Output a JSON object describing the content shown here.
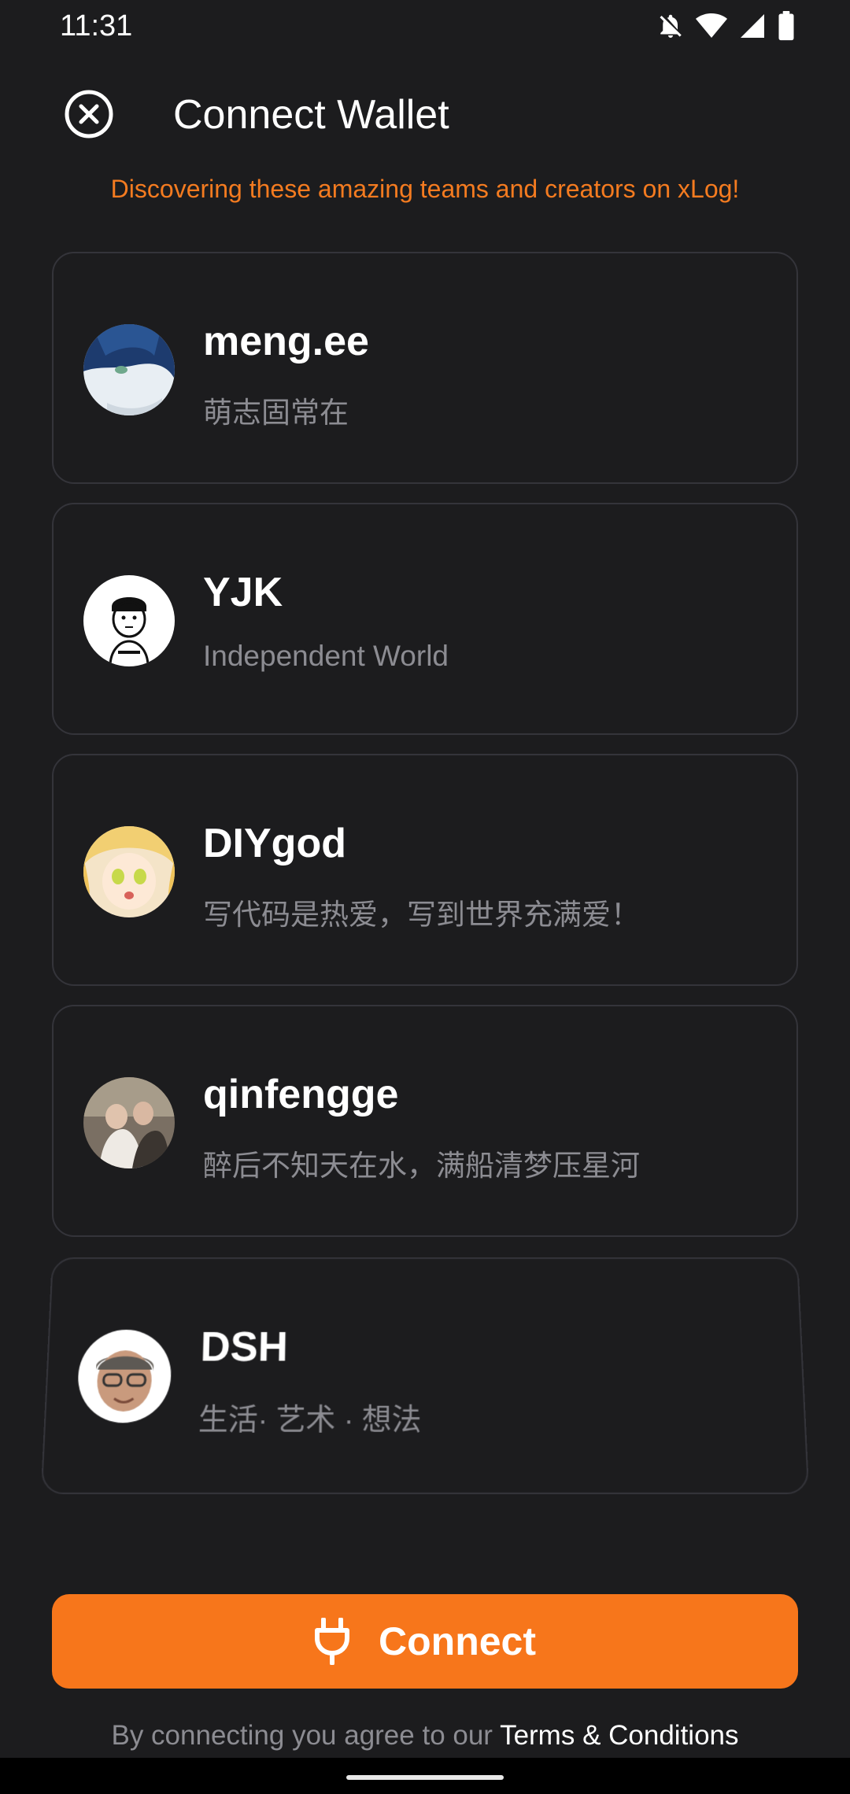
{
  "status_bar": {
    "time": "11:31",
    "icons": [
      "notifications-off-icon",
      "wifi-icon",
      "cellular-signal-icon",
      "battery-icon"
    ]
  },
  "header": {
    "title": "Connect Wallet",
    "close_icon": "close-circle-icon"
  },
  "subtitle": "Discovering these amazing teams and creators on xLog!",
  "creators": [
    {
      "name": "meng.ee",
      "description": "萌志固常在",
      "avatar": "anime-avatar-blue"
    },
    {
      "name": "YJK",
      "description": "Independent World",
      "avatar": "cartoon-avatar-boy"
    },
    {
      "name": "DIYgod",
      "description": "写代码是热爱，写到世界充满爱！",
      "avatar": "anime-avatar-blonde"
    },
    {
      "name": "qinfengge",
      "description": "醉后不知天在水，满船清梦压星河",
      "avatar": "photo-avatar-couple"
    },
    {
      "name": "DSH",
      "description": "生活· 艺术 · 想法",
      "avatar": "memoji-avatar"
    }
  ],
  "connect_button": {
    "label": "Connect",
    "icon": "plug-icon"
  },
  "terms": {
    "prefix": "By connecting you agree to our",
    "link": "Terms & Conditions"
  },
  "colors": {
    "background": "#1c1c1e",
    "accent": "#f7761b",
    "subtitle": "#f47b20",
    "muted_text": "#8c8c92",
    "card_border": "#34343a"
  }
}
